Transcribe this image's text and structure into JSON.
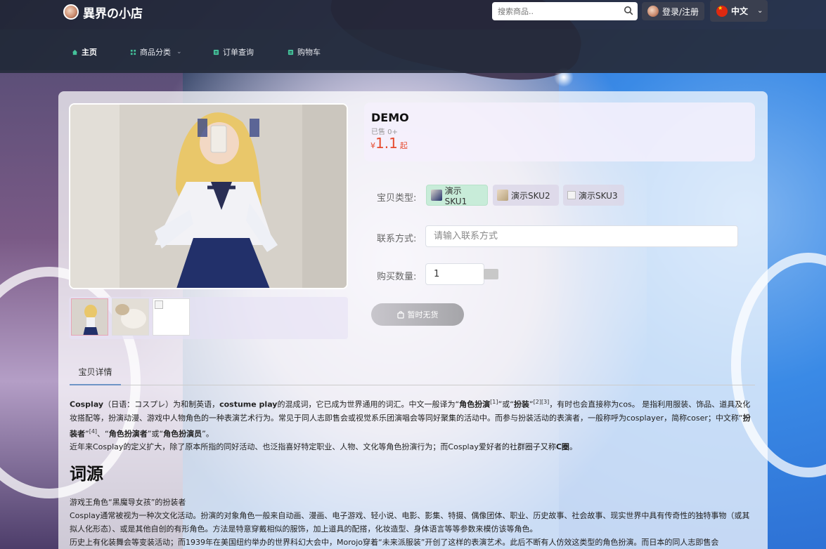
{
  "header": {
    "brand": "異界の小店",
    "search_placeholder": "搜索商品..",
    "login_label": "登录/注册",
    "lang_label": "中文"
  },
  "nav": {
    "items": [
      {
        "label": "主页",
        "icon": "home-icon"
      },
      {
        "label": "商品分类",
        "icon": "grid-icon"
      },
      {
        "label": "订单查询",
        "icon": "receipt-icon"
      },
      {
        "label": "购物车",
        "icon": "cart-icon"
      }
    ]
  },
  "product": {
    "title": "DEMO",
    "sold": "已售 0+",
    "currency": "¥",
    "price": "1.1",
    "price_suffix": "起",
    "sku_label": "宝贝类型:",
    "skus": [
      "演示SKU1",
      "演示SKU2",
      "演示SKU3"
    ],
    "contact_label": "联系方式:",
    "contact_placeholder": "请输入联系方式",
    "qty_label": "购买数量:",
    "qty_value": "1",
    "buy_label": "暂时无货"
  },
  "tabs": {
    "detail": "宝贝详情"
  },
  "detail": {
    "p1_a": "Cosplay",
    "p1_b": "（日语：コスプレ）为和制英语，",
    "p1_c": "costume play",
    "p1_d": "的混成词，它已成为世界通用的词汇。中文一般译为“",
    "p1_e": "角色扮演",
    "p1_f": "[1]",
    "p1_g": "”或“",
    "p1_h": "扮装",
    "p1_i": "”",
    "p1_j": "[2][3]",
    "p1_k": "，有时也会直接称为cos。 是指利用服装、饰品、道具及化妆搭配等，扮演动漫、游戏中人物角色的一种表演艺术行为。常见于同人志即售会或视觉系乐团演唱会等同好聚集的活动中。而参与扮装活动的表演者，一般称呼为cosplayer，简称coser；中文称“",
    "p1_l": "扮装者",
    "p1_m": "”",
    "p1_n": "[4]",
    "p1_o": "、“",
    "p1_p": "角色扮演者",
    "p1_q": "”或“",
    "p1_r": "角色扮演员",
    "p1_s": "”。",
    "p2_a": "近年来Cosplay的定义扩大，除了原本所指的同好活动、也泛指喜好特定职业、人物、文化等角色扮演行为；而Cosplay爱好者的社群圈子又称",
    "p2_b": "C圈",
    "p2_c": "。",
    "h2": "词源",
    "p3": "游戏王角色“黑魔导女孩”的扮装者",
    "p4": "Cosplay通常被视为一种次文化活动。扮演的对象角色一般来自动画、漫画、电子游戏、轻小说、电影、影集、特摄、偶像团体、职业、历史故事、社会故事、现实世界中具有传奇性的独特事物（或其拟人化形态）、或是其他自创的有形角色。方法是特意穿戴相似的服饰，加上道具的配搭，化妆造型、身体语言等等参数来模仿该等角色。",
    "p5": "历史上有化装舞会等变装活动；而1939年在美国纽约举办的世界科幻大会中，Morojo穿着“未来派服装”开创了这样的表演艺术。此后不断有人仿效这类型的角色扮演。而日本的同人志即售会"
  },
  "colors": {
    "accent": "#6f95c6",
    "price": "#e64a2e",
    "sku_selected": "#c8ecd9"
  }
}
